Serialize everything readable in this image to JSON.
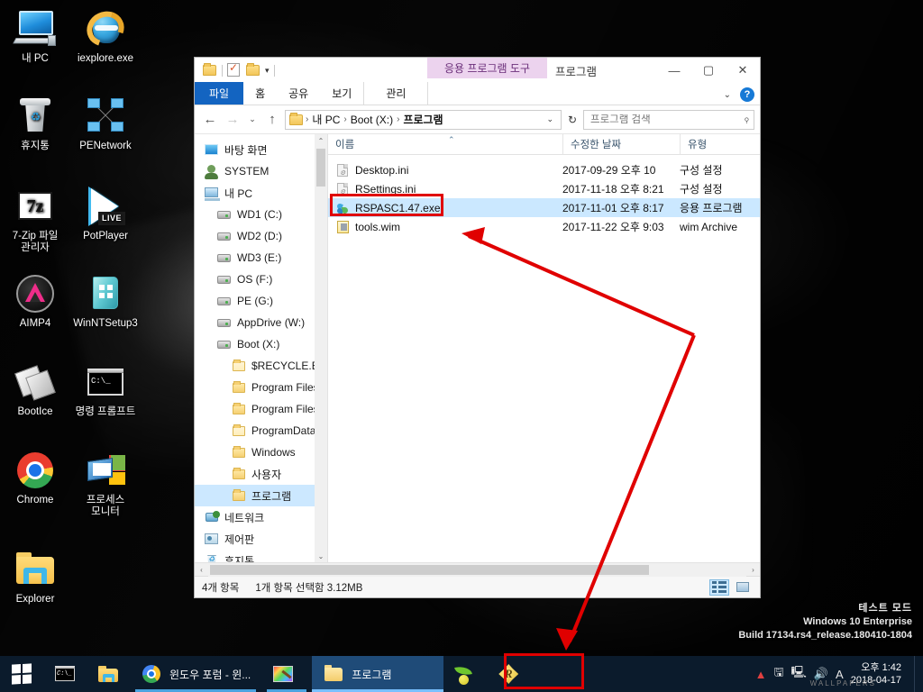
{
  "desktop": {
    "icons": [
      {
        "name": "내 PC",
        "icon": "computer-icon"
      },
      {
        "name": "iexplore.exe",
        "icon": "internet-explorer-icon"
      },
      {
        "name": "휴지통",
        "icon": "recycle-bin-icon"
      },
      {
        "name": "PENetwork",
        "icon": "network-icon"
      },
      {
        "name": "7-Zip 파일\n관리자",
        "icon": "seven-zip-icon"
      },
      {
        "name": "PotPlayer",
        "icon": "potplayer-icon",
        "badge": "LIVE"
      },
      {
        "name": "AIMP4",
        "icon": "aimp-icon"
      },
      {
        "name": "WinNTSetup3",
        "icon": "winntsetup-icon"
      },
      {
        "name": "BootIce",
        "icon": "bootice-icon"
      },
      {
        "name": "명령 프롬프트",
        "icon": "command-prompt-icon"
      },
      {
        "name": "Chrome",
        "icon": "chrome-icon"
      },
      {
        "name": "프로세스\n모니터",
        "icon": "process-monitor-icon"
      },
      {
        "name": "Explorer",
        "icon": "explorer-folder-icon"
      }
    ]
  },
  "watermark": {
    "line1": "테스트 모드",
    "line2": "Windows 10 Enterprise",
    "line3": "Build 17134.rs4_release.180410-1804"
  },
  "explorer": {
    "title": "프로그램",
    "contextual_tab": "응용 프로그램 도구",
    "quick_access": {
      "folder_icon": "folder-icon",
      "properties_icon": "properties-icon",
      "new_folder_icon": "new-folder-icon",
      "customize_caret": "▾"
    },
    "window_controls": {
      "minimize": "—",
      "maximize": "▢",
      "close": "✕",
      "ribbon_caret": "⌄",
      "help": "?"
    },
    "ribbon_tabs": [
      {
        "label": "파일",
        "state": "file"
      },
      {
        "label": "홈",
        "state": "normal"
      },
      {
        "label": "공유",
        "state": "normal"
      },
      {
        "label": "보기",
        "state": "normal"
      },
      {
        "label": "관리",
        "state": "contextual"
      }
    ],
    "address": {
      "back": "←",
      "forward": "→",
      "recent_caret": "⌄",
      "up": "↑",
      "crumbs": [
        "내 PC",
        "Boot (X:)",
        "프로그램"
      ],
      "separator": "›",
      "dropdown_caret": "⌄",
      "refresh": "↻"
    },
    "search": {
      "placeholder": "프로그램 검색",
      "value": "",
      "icon": "search-icon"
    },
    "nav_pane": [
      {
        "label": "바탕 화면",
        "icon": "desktop-icon",
        "level": 0,
        "selected": false
      },
      {
        "label": "SYSTEM",
        "icon": "user-icon",
        "level": 0,
        "selected": false
      },
      {
        "label": "내 PC",
        "icon": "this-pc-icon",
        "level": 0,
        "selected": false
      },
      {
        "label": "WD1 (C:)",
        "icon": "drive-icon",
        "level": 1,
        "selected": false
      },
      {
        "label": "WD2 (D:)",
        "icon": "drive-icon",
        "level": 1,
        "selected": false
      },
      {
        "label": "WD3 (E:)",
        "icon": "drive-icon",
        "level": 1,
        "selected": false
      },
      {
        "label": "OS (F:)",
        "icon": "drive-icon",
        "level": 1,
        "selected": false
      },
      {
        "label": "PE (G:)",
        "icon": "drive-icon",
        "level": 1,
        "selected": false
      },
      {
        "label": "AppDrive (W:)",
        "icon": "drive-icon",
        "level": 1,
        "selected": false
      },
      {
        "label": "Boot (X:)",
        "icon": "drive-icon",
        "level": 1,
        "selected": false
      },
      {
        "label": "$RECYCLE.BIN",
        "icon": "folder-pale-icon",
        "level": 2,
        "selected": false
      },
      {
        "label": "Program Files",
        "icon": "folder-icon",
        "level": 2,
        "selected": false
      },
      {
        "label": "Program Files (",
        "icon": "folder-icon",
        "level": 2,
        "selected": false
      },
      {
        "label": "ProgramData",
        "icon": "folder-pale-icon",
        "level": 2,
        "selected": false
      },
      {
        "label": "Windows",
        "icon": "folder-icon",
        "level": 2,
        "selected": false
      },
      {
        "label": "사용자",
        "icon": "folder-icon",
        "level": 2,
        "selected": false
      },
      {
        "label": "프로그램",
        "icon": "folder-icon",
        "level": 2,
        "selected": true
      },
      {
        "label": "네트워크",
        "icon": "network-place-icon",
        "level": 0,
        "selected": false
      },
      {
        "label": "제어판",
        "icon": "control-panel-icon",
        "level": 0,
        "selected": false
      },
      {
        "label": "휴지통",
        "icon": "recycle-bin-icon",
        "level": 0,
        "selected": false
      }
    ],
    "columns": [
      {
        "label": "이름",
        "key": "name"
      },
      {
        "label": "수정한 날짜",
        "key": "date"
      },
      {
        "label": "유형",
        "key": "type"
      }
    ],
    "sort_indicator": "⌃",
    "files": [
      {
        "name": "Desktop.ini",
        "date": "2017-09-29 오후 10",
        "type": "구성 설정",
        "icon": "ini-file-icon",
        "selected": false
      },
      {
        "name": "RSettings.ini",
        "date": "2017-11-18 오후 8:21",
        "type": "구성 설정",
        "icon": "ini-file-icon",
        "selected": false
      },
      {
        "name": "RSPASC1.47.exe",
        "date": "2017-11-01 오후 8:17",
        "type": "응용 프로그램",
        "icon": "exe-file-icon",
        "selected": true
      },
      {
        "name": "tools.wim",
        "date": "2017-11-22 오후 9:03",
        "type": "wim Archive",
        "icon": "wim-file-icon",
        "selected": false
      }
    ],
    "status": {
      "item_count": "4개 항목",
      "selection": "1개 항목 선택함 3.12MB",
      "view_details_icon": "details-view-icon",
      "view_thumbnails_icon": "thumbnail-view-icon"
    },
    "hscroll": {
      "left_arrow": "‹",
      "right_arrow": "›"
    },
    "vscroll": {
      "up_arrow": "⌃",
      "down_arrow": "⌄"
    }
  },
  "taskbar": {
    "start": {
      "icon": "windows-start-icon"
    },
    "pinned": [
      {
        "label": "명령 프롬프트",
        "icon": "cmd-taskbar-icon"
      },
      {
        "label": "파일 탐색기",
        "icon": "explorer-taskbar-icon"
      }
    ],
    "tasks": [
      {
        "label": "윈도우 포럼 - 윈...",
        "icon": "chrome-taskbar-icon",
        "active": false,
        "running": true
      },
      {
        "label": "",
        "icon": "paint-taskbar-icon",
        "active": false,
        "running": true
      },
      {
        "label": "프로그램",
        "icon": "folder-taskbar-icon",
        "active": true,
        "running": true
      }
    ],
    "tray_apps": [
      {
        "label": "Leaf",
        "icon": "leaf-tray-icon"
      },
      {
        "label": "R",
        "icon": "r-tray-icon"
      }
    ],
    "tray": {
      "hidden_icon": "show-hidden-icons-icon",
      "usb_icon": "safely-remove-hardware-icon",
      "network_icon": "network-tray-icon",
      "volume_icon": "volume-tray-icon",
      "ime_icon": "A",
      "time": "오후 1:42",
      "date": "2018-04-17",
      "wallpaper_mark": "WALLPAPERS"
    }
  },
  "annotations": {
    "file_highlight_color": "#e00000",
    "taskbar_highlight_color": "#e00000",
    "arrow_color": "#e00000"
  }
}
